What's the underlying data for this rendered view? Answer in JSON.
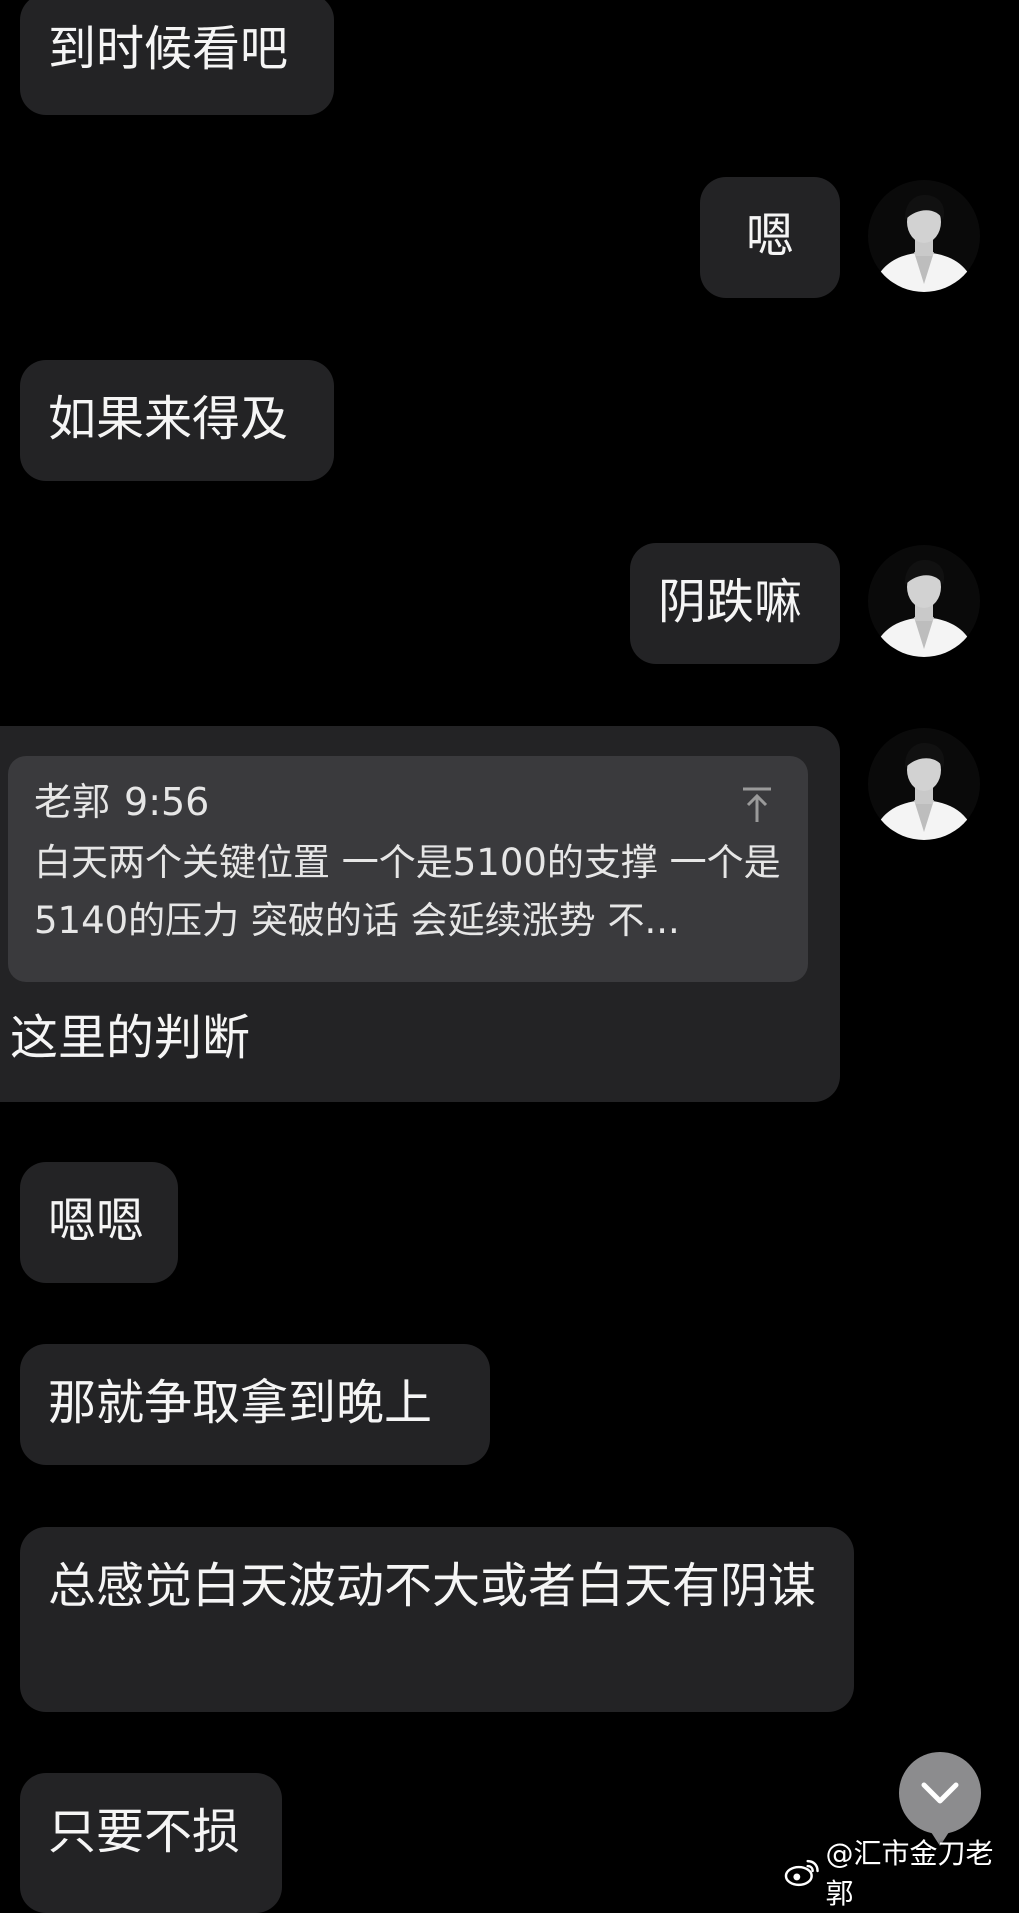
{
  "messages": [
    {
      "side": "left",
      "text": "到时候看吧"
    },
    {
      "side": "right",
      "text": "嗯"
    },
    {
      "side": "left",
      "text": "如果来得及"
    },
    {
      "side": "right",
      "text": "阴跌嘛"
    },
    {
      "side": "right",
      "quote": {
        "author": "老郭",
        "time": "9:56",
        "text": "白天两个关键位置 一个是5100的支撑 一个是5140的压力  突破的话 会延续涨势 不..."
      },
      "text": "这里的判断"
    },
    {
      "side": "left",
      "text": "嗯嗯"
    },
    {
      "side": "left",
      "text": "那就争取拿到晚上"
    },
    {
      "side": "left",
      "text": "总感觉白天波动不大或者白天有阴谋"
    },
    {
      "side": "left",
      "text": "只要不损"
    }
  ],
  "watermark": {
    "text": "@汇市金刀老郭",
    "icon": "weibo-logo-icon"
  },
  "colors": {
    "background": "#000000",
    "bubble": "#232325",
    "quote_card": "#3a3a3d",
    "scroll_button": "#8c8c8e"
  }
}
